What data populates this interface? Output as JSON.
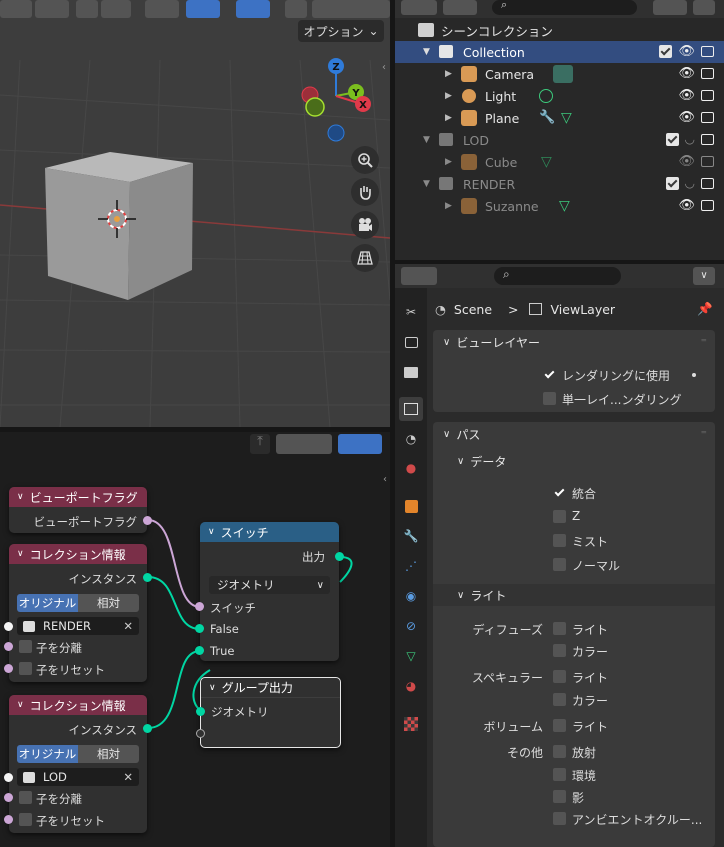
{
  "viewport": {
    "options_label": "オプション"
  },
  "outliner": {
    "root_label": "シーンコレクション",
    "rows": [
      {
        "label": "Collection"
      },
      {
        "label": "Camera"
      },
      {
        "label": "Light"
      },
      {
        "label": "Plane"
      },
      {
        "label": "LOD"
      },
      {
        "label": "Cube"
      },
      {
        "label": "RENDER"
      },
      {
        "label": "Suzanne"
      }
    ]
  },
  "nodes": {
    "viewport_flag": {
      "title": "ビューポートフラグ",
      "output": "ビューポートフラグ"
    },
    "collection_info_1": {
      "title": "コレクション情報",
      "output": "インスタンス",
      "seg_a": "オリジナル",
      "seg_b": "相対",
      "collection": "RENDER",
      "separate": "子を分離",
      "reset": "子をリセット"
    },
    "collection_info_2": {
      "title": "コレクション情報",
      "output": "インスタンス",
      "seg_a": "オリジナル",
      "seg_b": "相対",
      "collection": "LOD",
      "separate": "子を分離",
      "reset": "子をリセット"
    },
    "switch": {
      "title": "スイッチ",
      "output": "出力",
      "type": "ジオメトリ",
      "switch": "スイッチ",
      "false": "False",
      "true": "True"
    },
    "group_output": {
      "title": "グループ出力",
      "input": "ジオメトリ"
    }
  },
  "properties": {
    "breadcrumb_scene": "Scene",
    "breadcrumb_sep": ">",
    "breadcrumb_layer": "ViewLayer",
    "view_layer_panel": {
      "title": "ビューレイヤー",
      "use_for_render": "レンダリングに使用",
      "single_layer": "単一レイ...ンダリング"
    },
    "passes_panel": {
      "title": "パス",
      "data_sub": {
        "title": "データ",
        "combined": "統合",
        "z": "Z",
        "mist": "ミスト",
        "normal": "ノーマル"
      },
      "light_sub": {
        "title": "ライト",
        "diffuse_label": "ディフューズ",
        "diffuse_light": "ライト",
        "diffuse_color": "カラー",
        "specular_label": "スペキュラー",
        "specular_light": "ライト",
        "specular_color": "カラー",
        "volume_label": "ボリューム",
        "volume_light": "ライト",
        "other_label": "その他",
        "emission": "放射",
        "environment": "環境",
        "shadow": "影",
        "ao": "アンビエントオクルー..."
      }
    }
  }
}
